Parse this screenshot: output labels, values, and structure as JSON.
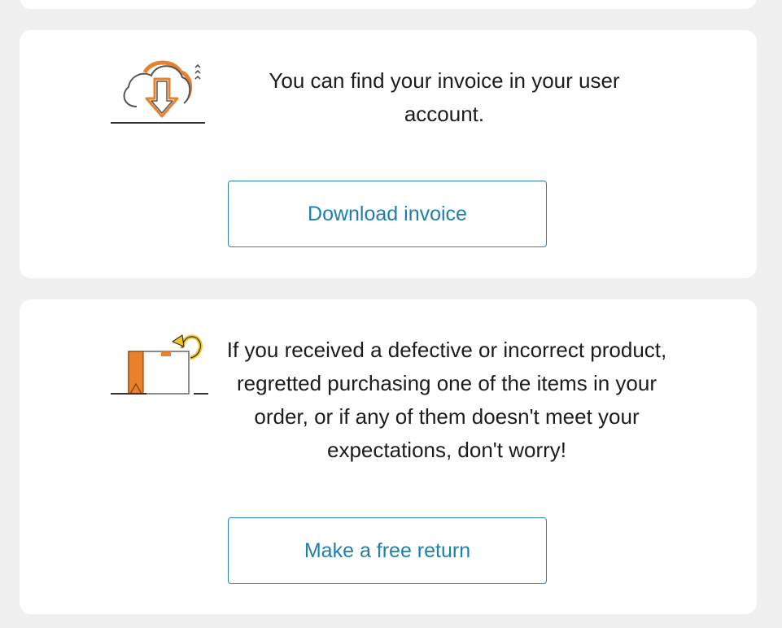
{
  "invoice_card": {
    "illustration_icon": "cloud-download-icon",
    "message": "You can find your invoice in your user account.",
    "button_label": "Download invoice"
  },
  "return_card": {
    "illustration_icon": "return-box-icon",
    "message": "If you received a defective or incorrect product, regretted purchasing one of the items in your order, or if any of them doesn't meet your expectations, don't worry!",
    "button_label": "Make a free return"
  },
  "colors": {
    "background": "#f0f0f0",
    "card": "#ffffff",
    "button_border": "#2f7fa9",
    "button_text": "#1f7fab",
    "illustration_accent": "#e8802c",
    "illustration_yellow": "#f2c428"
  }
}
